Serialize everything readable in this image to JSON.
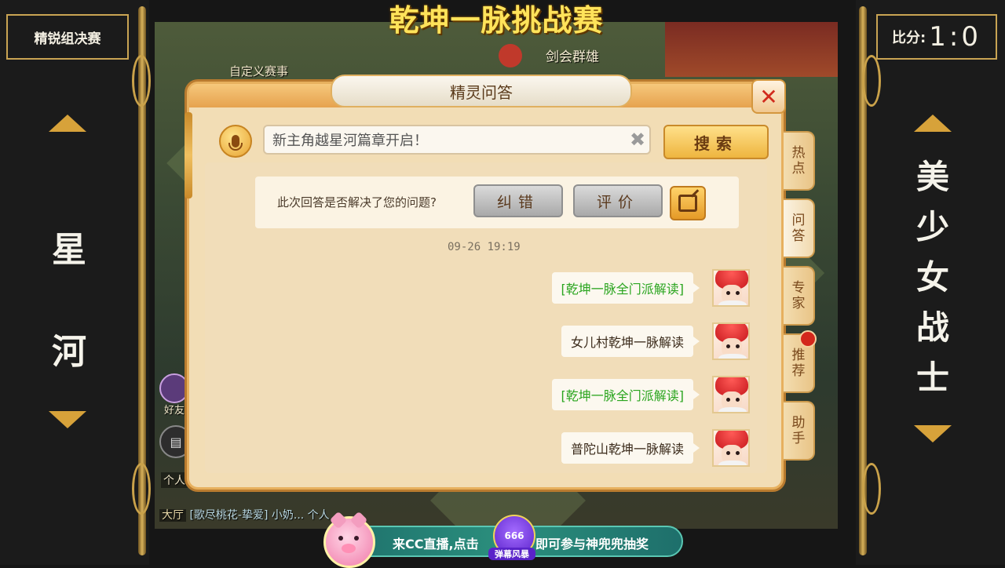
{
  "broadcast": {
    "event_title": "乾坤一脉挑战赛",
    "round_label": "精锐组决赛",
    "score_label": "比分:",
    "score_value": "1:0",
    "left_team": "星河",
    "right_team": "美少女战士",
    "accent_gold": "#c9a453",
    "title_yellow": "#ffe35a"
  },
  "game": {
    "top_label": "剑会群雄",
    "custom_match_label": "自定义赛事",
    "friends_label": "好友",
    "personal_label": "个人",
    "chat_channel": "大厅",
    "chat_snippet": "[歌尽桃花-挚爱] 小奶... 个人"
  },
  "dialog": {
    "title": "精灵问答",
    "search": {
      "value": "新主角越星河篇章开启！",
      "button": "搜索"
    },
    "feedback": {
      "question": "此次回答是否解决了您的问题?",
      "correct_button": "纠错",
      "rate_button": "评价"
    },
    "timestamp": "09-26 19:19",
    "messages": [
      {
        "text": "[乾坤一脉全门派解读]",
        "style": "green"
      },
      {
        "text": "女儿村乾坤一脉解读",
        "style": "normal"
      },
      {
        "text": "[乾坤一脉全门派解读]",
        "style": "green"
      },
      {
        "text": "普陀山乾坤一脉解读",
        "style": "normal"
      }
    ],
    "side_tabs": [
      "热点",
      "问答",
      "专家",
      "推荐",
      "助手"
    ],
    "active_tab": "问答"
  },
  "banner": {
    "text_left": "来CC直播,点击",
    "text_right": "即可参与神兜兜抽奖",
    "badge_text": "666",
    "badge_sub": "弹幕风暴"
  }
}
